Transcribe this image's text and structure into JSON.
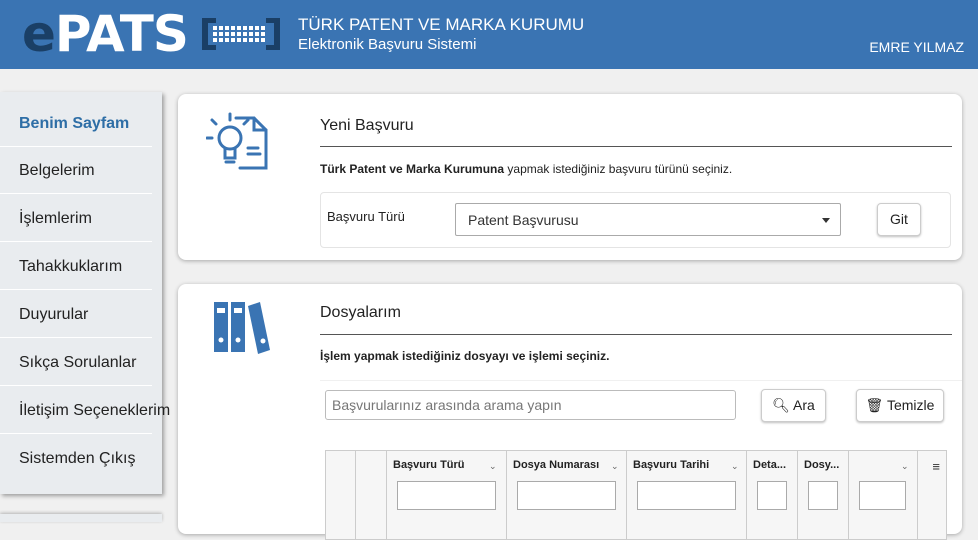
{
  "header": {
    "logo_e": "e",
    "logo_rest": "PATS",
    "org_title": "TÜRK PATENT VE MARKA KURUMU",
    "org_subtitle": "Elektronik Başvuru Sistemi",
    "user": "EMRE YILMAZ",
    "accent_color": "#3a74b3"
  },
  "sidebar": {
    "items": [
      {
        "label": "Benim Sayfam",
        "active": true
      },
      {
        "label": "Belgelerim"
      },
      {
        "label": "İşlemlerim"
      },
      {
        "label": "Tahakkuklarım"
      },
      {
        "label": "Duyurular"
      },
      {
        "label": "Sıkça Sorulanlar"
      },
      {
        "label": "İletişim Seçeneklerim"
      },
      {
        "label": "Sistemden Çıkış"
      }
    ]
  },
  "new_application": {
    "icon": "lightbulb-document-icon",
    "title": "Yeni Başvuru",
    "desc_bold": "Türk Patent ve Marka Kurumuna",
    "desc_rest": " yapmak istediğiniz başvuru türünü seçiniz.",
    "type_label": "Başvuru Türü",
    "selected_type": "Patent Başvurusu",
    "go_button": "Git"
  },
  "files": {
    "icon": "binders-icon",
    "title": "Dosyalarım",
    "desc": "İşlem yapmak istediğiniz dosyayı ve işlemi seçiniz.",
    "search_placeholder": "Başvurularınız arasında arama yapın",
    "search_button": "Ara",
    "clear_button": "Temizle",
    "columns": [
      "Başvuru Türü",
      "Dosya Numarası",
      "Başvuru Tarihi",
      "Deta...",
      "Dosy...",
      ""
    ]
  }
}
